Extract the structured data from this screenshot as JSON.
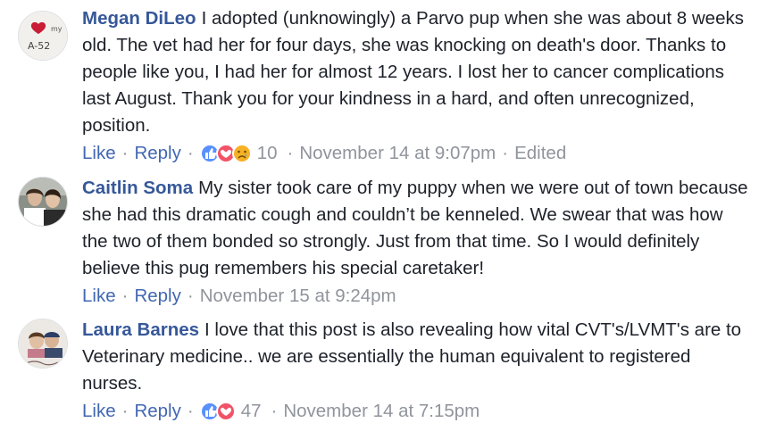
{
  "comments": [
    {
      "author": "Megan DiLeo",
      "text": "I adopted (unknowingly) a Parvo pup when she was about 8 weeks old. The vet had her for four days, she was knocking on death's door. Thanks to people like you, I had her for almost 12 years. I lost her to cancer complications last August. Thank you for your kindness in a hard, and often unrecognized, position.",
      "like": "Like",
      "reply": "Reply",
      "reactions": [
        "like-icon",
        "love-icon",
        "sad-icon"
      ],
      "reaction_count": "10",
      "timestamp": "November 14 at 9:07pm",
      "edited": "Edited",
      "avatar_text": "A-52",
      "avatar_small_text": "my"
    },
    {
      "author": "Caitlin Soma",
      "text": "My sister took care of my puppy when we were out of town because she had this dramatic cough and couldn’t be kenneled. We swear that was how the two of them bonded so strongly. Just from that time. So I would definitely believe this pug remembers his special caretaker!",
      "like": "Like",
      "reply": "Reply",
      "timestamp": "November 15 at 9:24pm"
    },
    {
      "author": "Laura Barnes",
      "text": "I love that this post is also revealing how vital CVT's/LVMT's are to Veterinary medicine.. we are essentially the human equivalent to registered nurses.",
      "like": "Like",
      "reply": "Reply",
      "reactions": [
        "like-icon",
        "love-icon"
      ],
      "reaction_count": "47",
      "timestamp": "November 14 at 7:15pm"
    }
  ],
  "separator": "·",
  "colors": {
    "author": "#365899",
    "link": "#4267b2",
    "meta": "#90949c",
    "like_reaction": "#5890ff",
    "love_reaction": "#f25268",
    "sad_reaction": "#f7b125"
  }
}
